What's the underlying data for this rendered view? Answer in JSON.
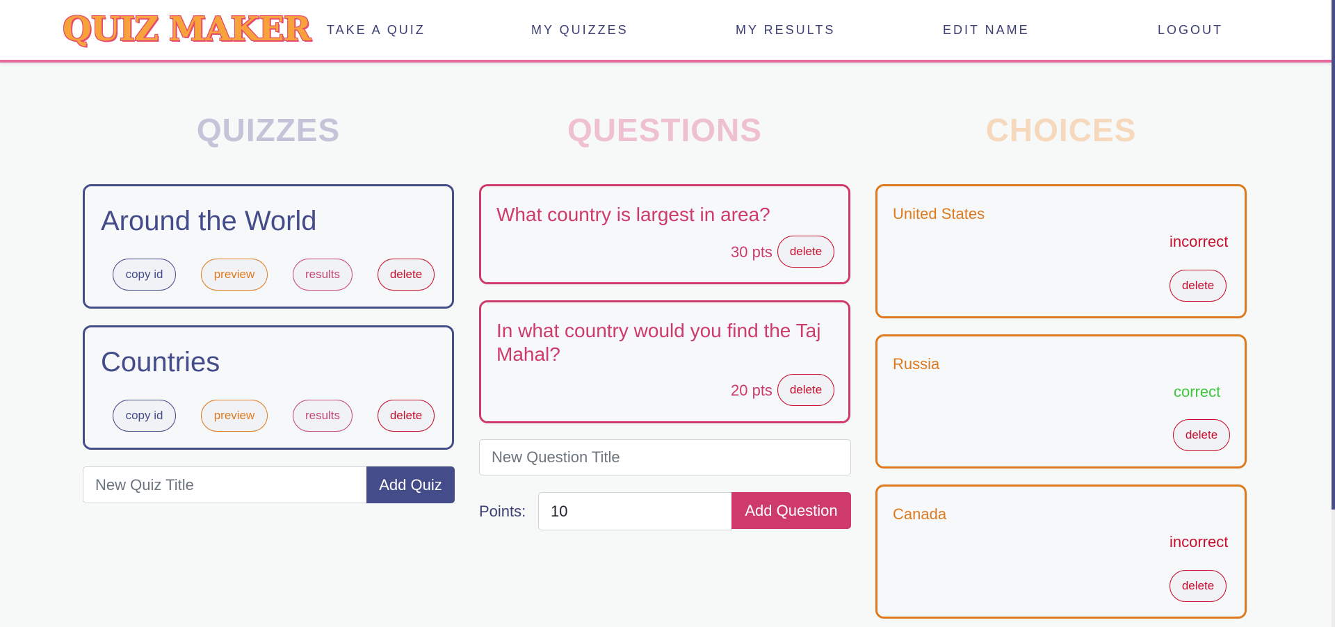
{
  "app": {
    "logo": "QUIZ MAKER"
  },
  "nav": {
    "take_quiz": "TAKE A QUIZ",
    "my_quizzes": "MY QUIZZES",
    "my_results": "MY RESULTS",
    "edit_name": "EDIT NAME",
    "logout": "LOGOUT"
  },
  "columns": {
    "quizzes": "QUIZZES",
    "questions": "QUESTIONS",
    "choices": "CHOICES"
  },
  "quizzes": [
    {
      "title": "Around the World",
      "copy": "copy id",
      "preview": "preview",
      "results": "results",
      "delete": "delete"
    },
    {
      "title": "Countries",
      "copy": "copy id",
      "preview": "preview",
      "results": "results",
      "delete": "delete"
    }
  ],
  "new_quiz": {
    "placeholder": "New Quiz Title",
    "button": "Add Quiz"
  },
  "questions": [
    {
      "title": "What country is largest in area?",
      "points": "30 pts",
      "delete": "delete"
    },
    {
      "title": "In what country would you find the Taj Mahal?",
      "points": "20 pts",
      "delete": "delete"
    }
  ],
  "new_question": {
    "placeholder": "New Question Title",
    "points_label": "Points:",
    "points_value": "10",
    "button": "Add Question"
  },
  "choices": [
    {
      "title": "United States",
      "status": "incorrect",
      "delete": "delete"
    },
    {
      "title": "Russia",
      "status": "correct",
      "delete": "delete"
    },
    {
      "title": "Canada",
      "status": "incorrect",
      "delete": "delete"
    }
  ],
  "colors": {
    "quiz_accent": "#454c8a",
    "question_accent": "#cf3a6c",
    "choice_accent": "#de7a1d",
    "correct": "#3dc83d",
    "incorrect": "#c8102e"
  }
}
